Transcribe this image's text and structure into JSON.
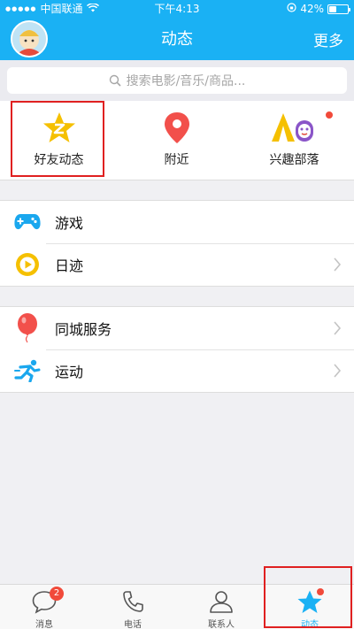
{
  "status": {
    "carrier": "中国联通",
    "time": "下午4:13",
    "battery_pct": "42%",
    "battery_level": 0.42
  },
  "header": {
    "title": "动态",
    "more": "更多"
  },
  "search": {
    "placeholder": "搜索电影/音乐/商品..."
  },
  "shortcuts": [
    {
      "label": "好友动态",
      "icon": "friends-star-icon"
    },
    {
      "label": "附近",
      "icon": "location-pin-icon"
    },
    {
      "label": "兴趣部落",
      "icon": "tribe-icon"
    }
  ],
  "group1": [
    {
      "label": "游戏",
      "icon": "gamepad-icon",
      "has_chevron": false
    },
    {
      "label": "日迹",
      "icon": "play-circle-icon",
      "has_chevron": true
    }
  ],
  "group2": [
    {
      "label": "同城服务",
      "icon": "balloon-icon",
      "has_chevron": true
    },
    {
      "label": "运动",
      "icon": "running-icon",
      "has_chevron": true
    }
  ],
  "tabs": [
    {
      "label": "消息",
      "badge": "2"
    },
    {
      "label": "电话"
    },
    {
      "label": "联系人"
    },
    {
      "label": "动态",
      "active": true
    }
  ],
  "colors": {
    "brand": "#1ab1f4",
    "badge": "#f14a3a",
    "highlight": "#e02020"
  }
}
